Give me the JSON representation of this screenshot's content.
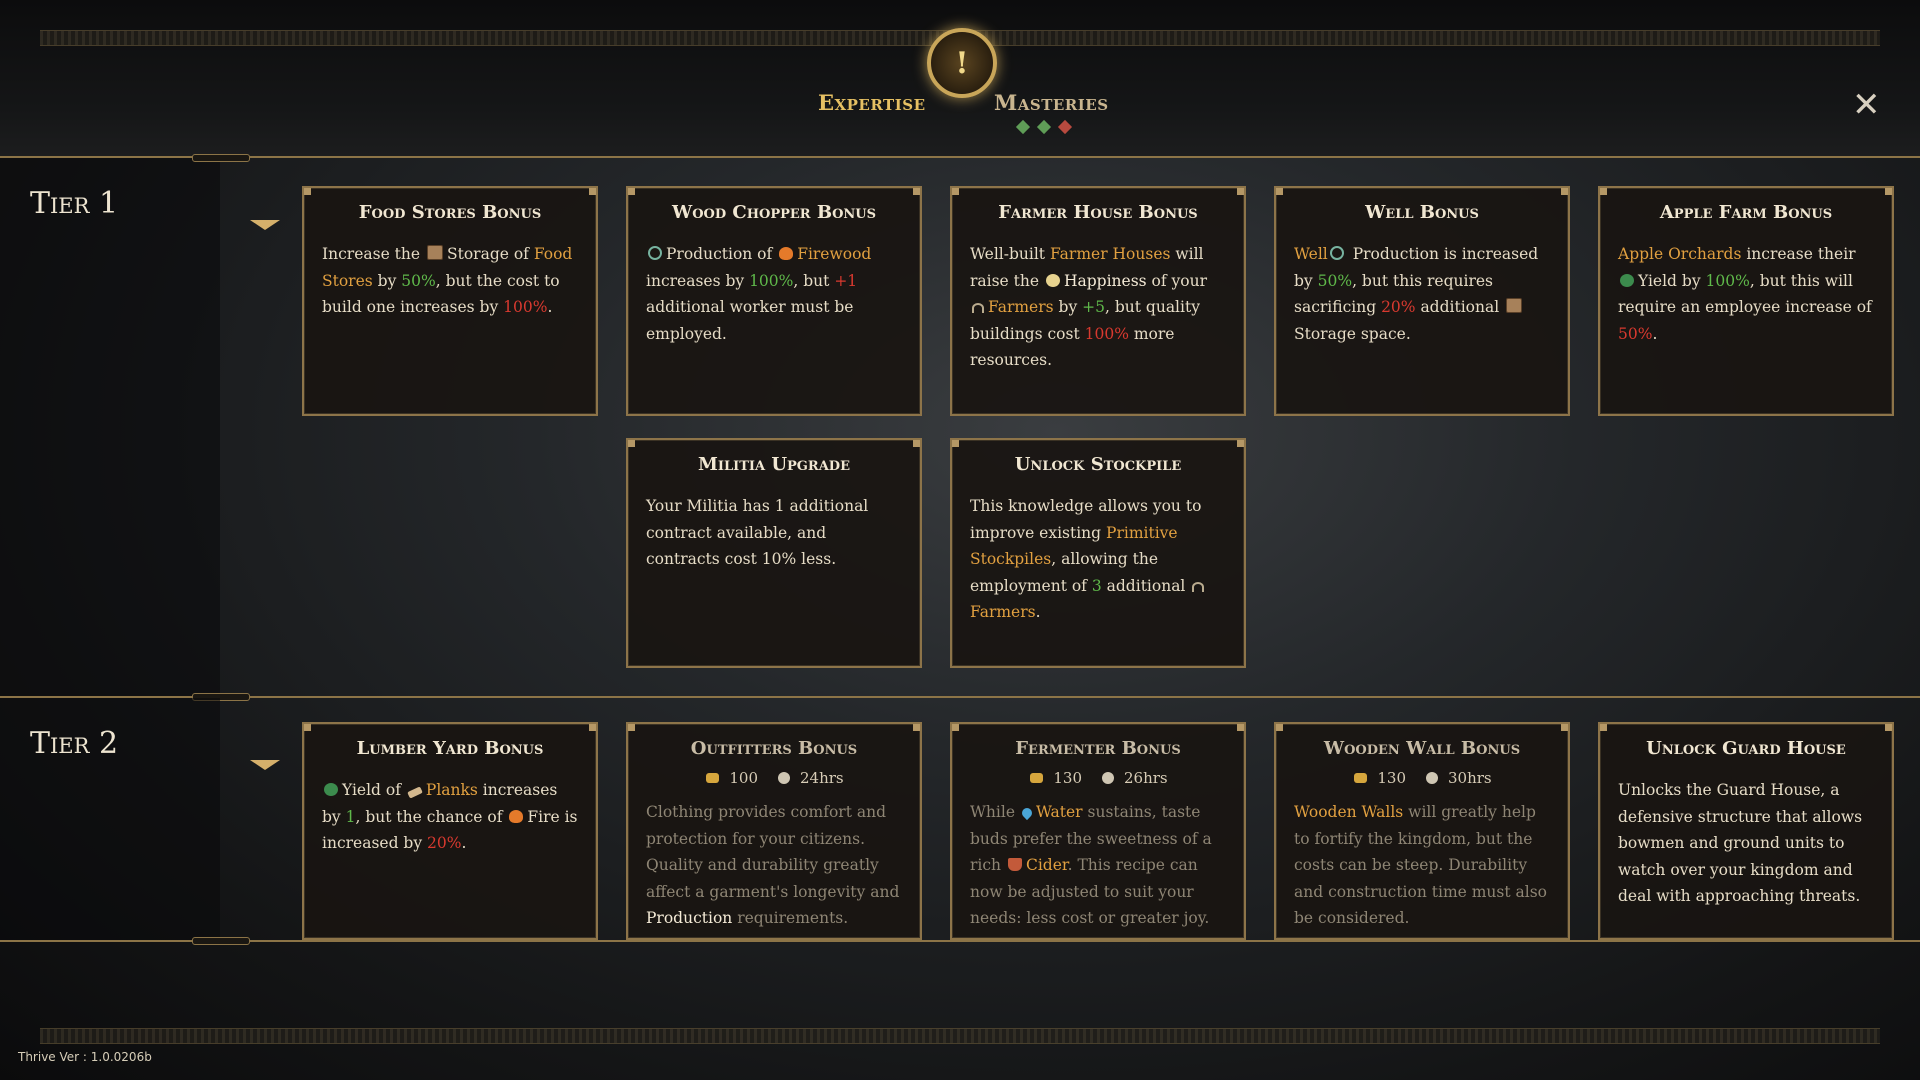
{
  "tabs": {
    "expertise": "Expertise",
    "masteries": "Masteries",
    "emblem": "!"
  },
  "mastery_diamonds": [
    "#5f9d57",
    "#5f9d57",
    "#b84a3f"
  ],
  "close": "✕",
  "tiers": [
    {
      "label": "Tier 1"
    },
    {
      "label": "Tier 2"
    }
  ],
  "cards": {
    "food_stores": {
      "title": "Food Stores Bonus",
      "t1": "Increase the ",
      "t2": "Storage of ",
      "food_stores": "Food Stores",
      "t3": " by ",
      "pct50": "50%",
      "t4": ", but the cost to build one increases by ",
      "pct100": "100%",
      "t5": "."
    },
    "wood_chopper": {
      "title": "Wood Chopper Bonus",
      "t1": "Production of ",
      "firewood": "Firewood",
      "t2": " increases by ",
      "pct100": "100%",
      "t3": ", but ",
      "plus1": "+1",
      "t4": " additional worker must be employed."
    },
    "farmer_house": {
      "title": "Farmer House Bonus",
      "t1": "Well-built ",
      "farmer_houses": "Farmer Houses",
      "t2": " will raise the ",
      "happiness": "Happiness",
      "t3": " of your ",
      "farmers": "Farmers",
      "t4": " by ",
      "plus5": "+5",
      "t5": ", but quality buildings cost ",
      "pct100": "100%",
      "t6": " more resources."
    },
    "well": {
      "title": "Well Bonus",
      "well": "Well",
      "t1": " Production is increased by ",
      "pct50": "50%",
      "t2": ", but this requires sacrificing ",
      "pct20": "20%",
      "t3": " additional ",
      "t4": "Storage space."
    },
    "apple_farm": {
      "title": "Apple Farm Bonus",
      "apple_orchards": "Apple Orchards",
      "t1": " increase their ",
      "t2": "Yield by ",
      "pct100": "100%",
      "t3": ", but this will require an employee increase of ",
      "pct50": "50%",
      "t4": "."
    },
    "militia": {
      "title": "Militia Upgrade",
      "body": "Your Militia has 1 additional contract available, and contracts cost 10% less."
    },
    "stockpile": {
      "title": "Unlock Stockpile",
      "t1": "This knowledge allows you to improve existing ",
      "primitive_stockpiles": "Primitive Stockpiles",
      "t2": ", allowing the employment of ",
      "three": "3",
      "t3": " additional ",
      "farmers": "Farmers",
      "t4": "."
    },
    "lumber_yard": {
      "title": "Lumber Yard Bonus",
      "t1": "Yield of ",
      "planks": "Planks",
      "t2": " increases by ",
      "one": "1",
      "t3": ", but the chance of ",
      "t4": "Fire is increased by ",
      "pct20": "20%",
      "t5": "."
    },
    "outfitters": {
      "title": "Outfitters Bonus",
      "cost": "100",
      "time": "24hrs",
      "t1": "Clothing provides comfort and protection for your citizens. Quality and durability greatly affect a garment's longevity and ",
      "production": "Production",
      "t2": " requirements."
    },
    "fermenter": {
      "title": "Fermenter Bonus",
      "cost": "130",
      "time": "26hrs",
      "t1": "While ",
      "water": "Water",
      "t2": " sustains, taste buds prefer the sweetness of a rich ",
      "cider": "Cider",
      "t3": ". This recipe can now be adjusted to suit your needs: less cost or greater joy."
    },
    "wooden_wall": {
      "title": "Wooden Wall Bonus",
      "cost": "130",
      "time": "30hrs",
      "wooden_walls": "Wooden Walls",
      "t1": " will greatly help to fortify the kingdom, but the costs can be steep. Durability and construction time must also be considered."
    },
    "guard_house": {
      "title": "Unlock Guard House",
      "body": "Unlocks the Guard House, a defensive structure that allows bowmen and ground units to watch over your kingdom and deal with approaching threats."
    }
  },
  "version": "Thrive Ver : 1.0.0206b"
}
